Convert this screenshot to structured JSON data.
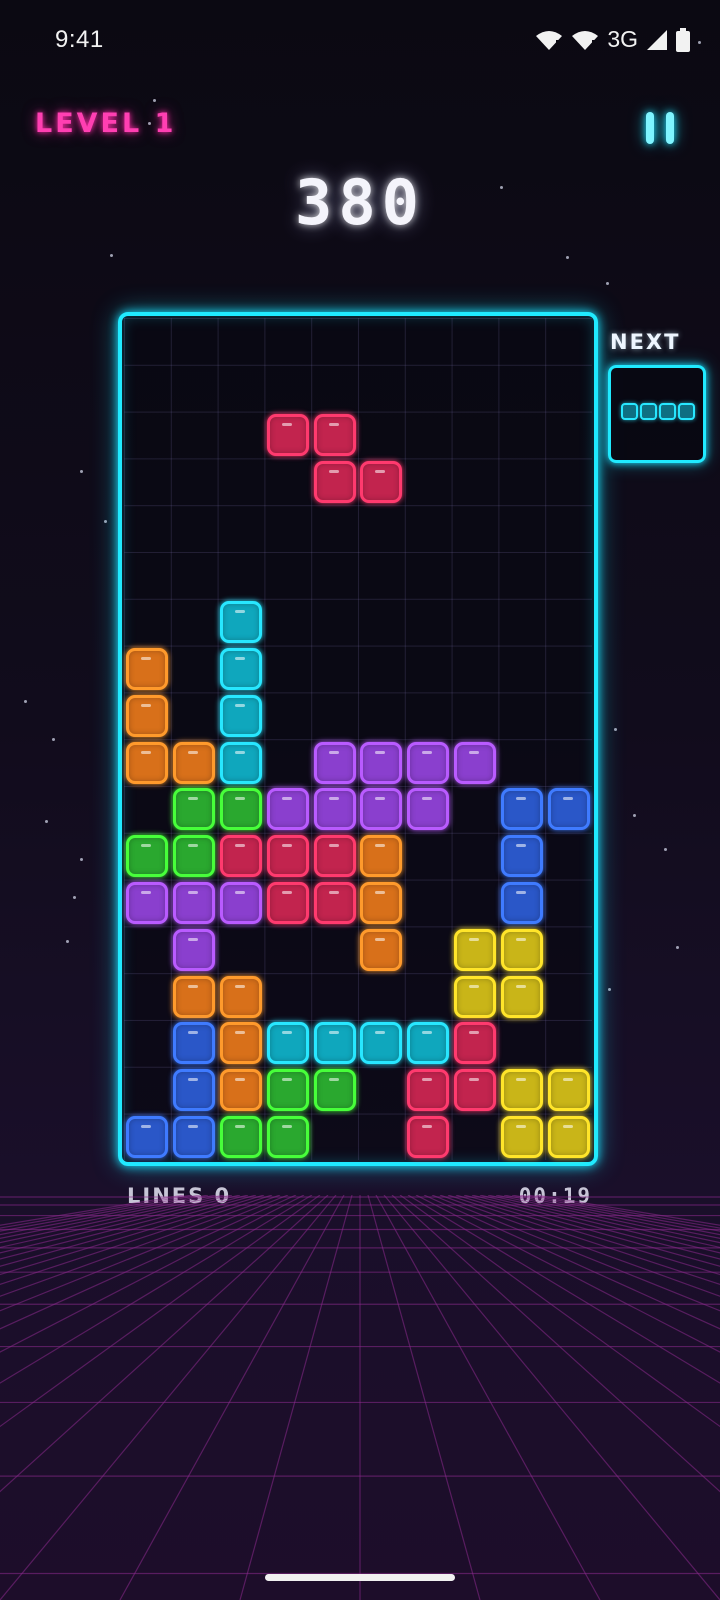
{
  "status_bar": {
    "time": "9:41",
    "network": "3G"
  },
  "hud": {
    "level": "LEVEL 1",
    "score": "380",
    "next_label": "NEXT",
    "lines": "LINES 0",
    "timer": "00:19"
  },
  "colors": {
    "accent": "#20eaff",
    "level": "#ff3fb2",
    "pieces": {
      "R": {
        "fill": "#c2244e",
        "border": "#ff3a6e"
      },
      "C": {
        "fill": "#0fa7bd",
        "border": "#28e7ff"
      },
      "O": {
        "fill": "#d8701a",
        "border": "#ff9a2c"
      },
      "G": {
        "fill": "#2aa82f",
        "border": "#47ff3a"
      },
      "P": {
        "fill": "#8a3fce",
        "border": "#b95bff"
      },
      "B": {
        "fill": "#2a57c8",
        "border": "#3f7bff"
      },
      "Y": {
        "fill": "#c9b518",
        "border": "#ffe52a"
      }
    }
  },
  "board": {
    "columns": 10,
    "rows": 18,
    "active_piece": {
      "shape": "Z",
      "color": "R",
      "cells": [
        [
          3,
          2
        ],
        [
          4,
          2
        ],
        [
          4,
          3
        ],
        [
          5,
          3
        ]
      ]
    },
    "stack": [
      ".........."
    ]
  },
  "next_piece": {
    "shape": "I",
    "color": "C"
  }
}
